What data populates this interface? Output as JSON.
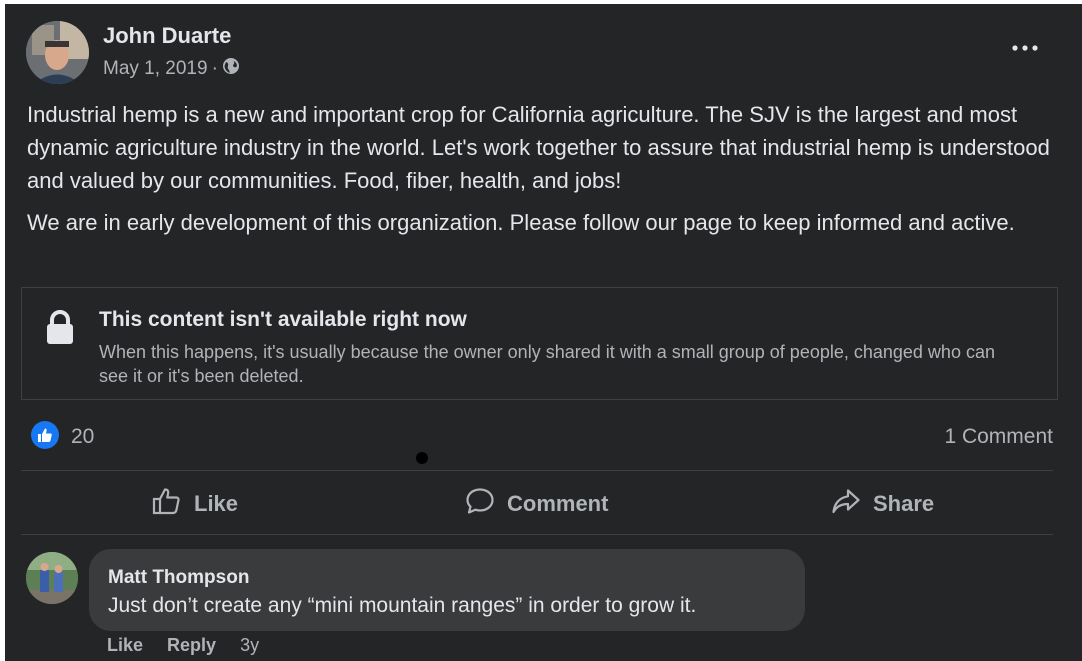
{
  "post": {
    "author": "John Duarte",
    "date": "May 1, 2019",
    "date_separator": "·",
    "audience_icon": "globe-icon",
    "more_icon": "more-options-icon",
    "paragraphs": [
      "Industrial hemp is a new and important crop for California agriculture.  The SJV is the largest and most dynamic agriculture industry in the world.  Let's work together to assure that industrial hemp is understood and valued by our communities.  Food, fiber, health, and jobs!",
      "We are in early development of this organization.  Please follow our page to keep informed and active."
    ]
  },
  "unavailable": {
    "title": "This content isn't available right now",
    "description": "When this happens, it's usually because the owner only shared it with a small group of people, changed who can see it or it's been deleted.",
    "icon": "lock-icon"
  },
  "reactions": {
    "like_count": "20",
    "comment_count": "1 Comment"
  },
  "actions": {
    "like": "Like",
    "comment": "Comment",
    "share": "Share"
  },
  "comment": {
    "author": "Matt Thompson",
    "text": "Just don’t create any “mini mountain ranges” in order to grow it.",
    "like_label": "Like",
    "reply_label": "Reply",
    "age": "3y"
  },
  "colors": {
    "background": "#242526",
    "bubble": "#3a3b3c",
    "accent": "#1877f2",
    "text_primary": "#e4e6eb",
    "text_secondary": "#b0b3b8"
  }
}
